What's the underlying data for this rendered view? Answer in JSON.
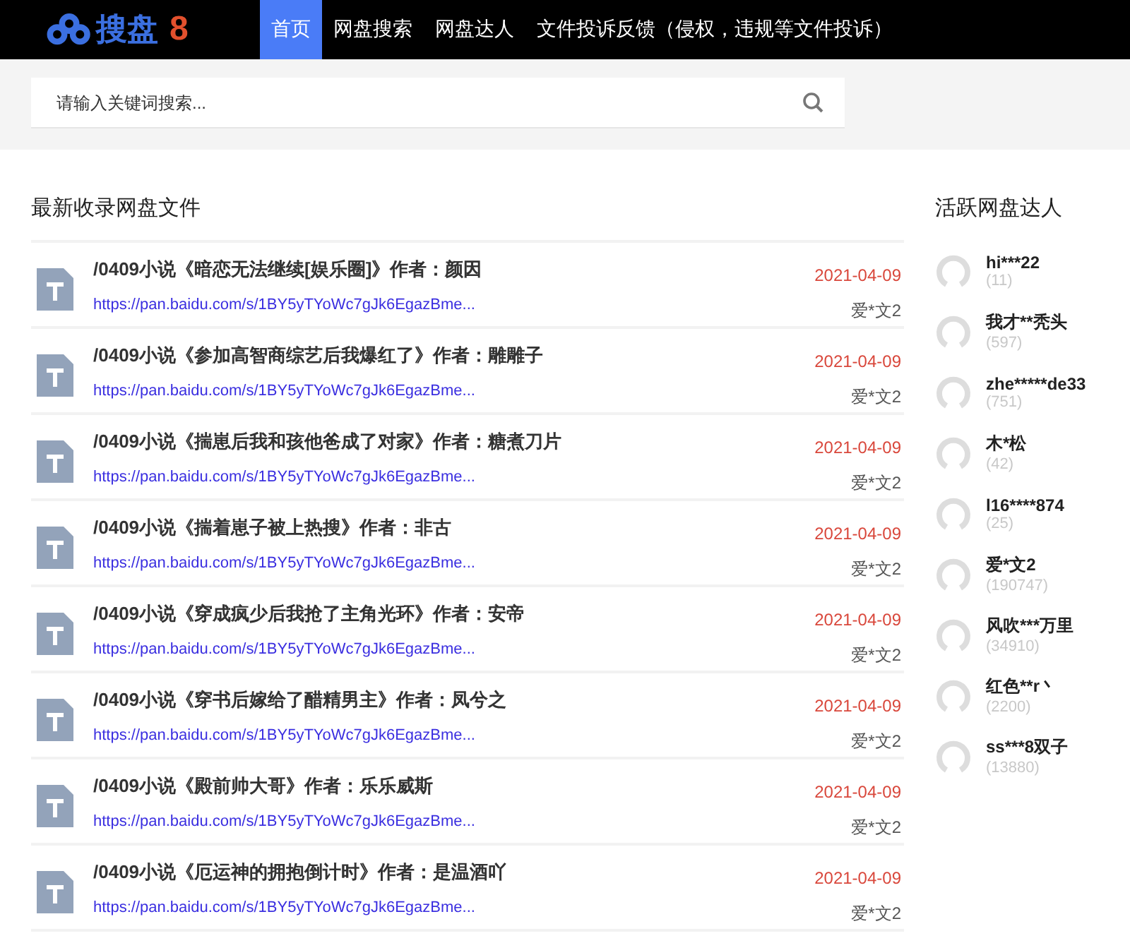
{
  "logo": {
    "text": "搜盘",
    "number": "8"
  },
  "nav": [
    {
      "label": "首页",
      "selected": true
    },
    {
      "label": "网盘搜索",
      "selected": false
    },
    {
      "label": "网盘达人",
      "selected": false
    },
    {
      "label": "文件投诉反馈（侵权，违规等文件投诉）",
      "selected": false
    }
  ],
  "search": {
    "placeholder": "请输入关键词搜索..."
  },
  "files": {
    "title": "最新收录网盘文件",
    "items": [
      {
        "name": "/0409小说《暗恋无法继续[娱乐圈]》作者：颜因",
        "url": "https://pan.baidu.com/s/1BY5yTYoWc7gJk6EgazBme...",
        "date": "2021-04-09",
        "user": "爱*文2"
      },
      {
        "name": "/0409小说《参加高智商综艺后我爆红了》作者：雕雕子",
        "url": "https://pan.baidu.com/s/1BY5yTYoWc7gJk6EgazBme...",
        "date": "2021-04-09",
        "user": "爱*文2"
      },
      {
        "name": "/0409小说《揣崽后我和孩他爸成了对家》作者：糖煮刀片",
        "url": "https://pan.baidu.com/s/1BY5yTYoWc7gJk6EgazBme...",
        "date": "2021-04-09",
        "user": "爱*文2"
      },
      {
        "name": "/0409小说《揣着崽子被上热搜》作者：非古",
        "url": "https://pan.baidu.com/s/1BY5yTYoWc7gJk6EgazBme...",
        "date": "2021-04-09",
        "user": "爱*文2"
      },
      {
        "name": "/0409小说《穿成疯少后我抢了主角光环》作者：安帝",
        "url": "https://pan.baidu.com/s/1BY5yTYoWc7gJk6EgazBme...",
        "date": "2021-04-09",
        "user": "爱*文2"
      },
      {
        "name": "/0409小说《穿书后嫁给了醋精男主》作者：凤兮之",
        "url": "https://pan.baidu.com/s/1BY5yTYoWc7gJk6EgazBme...",
        "date": "2021-04-09",
        "user": "爱*文2"
      },
      {
        "name": "/0409小说《殿前帅大哥》作者：乐乐威斯",
        "url": "https://pan.baidu.com/s/1BY5yTYoWc7gJk6EgazBme...",
        "date": "2021-04-09",
        "user": "爱*文2"
      },
      {
        "name": "/0409小说《厄运神的拥抱倒计时》作者：是温酒吖",
        "url": "https://pan.baidu.com/s/1BY5yTYoWc7gJk6EgazBme...",
        "date": "2021-04-09",
        "user": "爱*文2"
      }
    ]
  },
  "users": {
    "title": "活跃网盘达人",
    "items": [
      {
        "name": "hi***22",
        "count": "(11)"
      },
      {
        "name": "我才**秃头",
        "count": "(597)"
      },
      {
        "name": "zhe*****de33",
        "count": "(751)"
      },
      {
        "name": "木*松",
        "count": "(42)"
      },
      {
        "name": "l16****874",
        "count": "(25)"
      },
      {
        "name": "爱*文2",
        "count": "(190747)"
      },
      {
        "name": "风吹***万里",
        "count": "(34910)"
      },
      {
        "name": "红色**r丶",
        "count": "(2200)"
      },
      {
        "name": "ss***8双子",
        "count": "(13880)"
      }
    ]
  }
}
